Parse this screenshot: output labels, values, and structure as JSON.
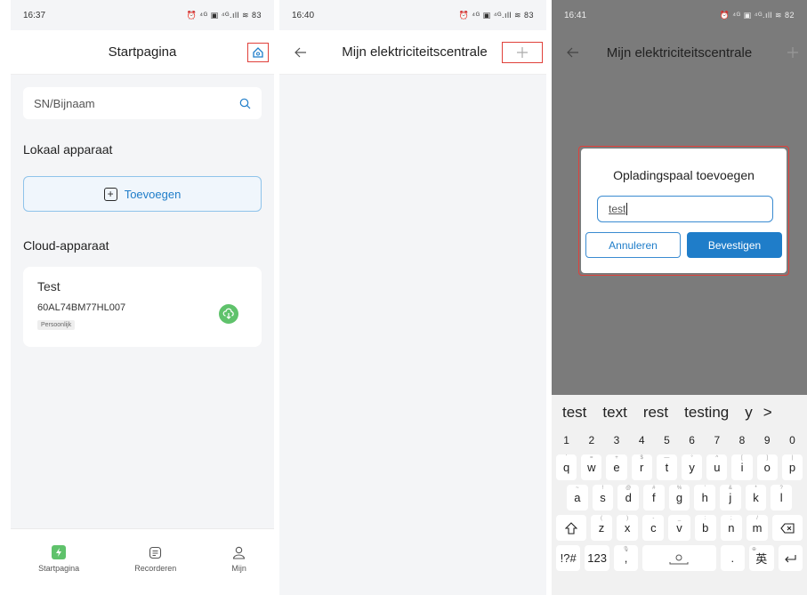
{
  "colors": {
    "accent": "#1f7dc9",
    "highlight": "#e0403a",
    "green": "#5fc26b"
  },
  "screen1": {
    "time": "16:37",
    "status_icons": "⏰ ⁴ᴳ ▣ ⁴ᴳ.ıll ≋ 83",
    "title": "Startpagina",
    "search_placeholder": "SN/Bijnaam",
    "local_section": "Lokaal apparaat",
    "add_label": "Toevoegen",
    "cloud_section": "Cloud-apparaat",
    "device": {
      "name": "Test",
      "sn": "60AL74BM77HL007",
      "tag": "Persoonlijk"
    },
    "tabs": [
      "Startpagina",
      "Recorderen",
      "Mijn"
    ]
  },
  "screen2": {
    "time": "16:40",
    "status_icons": "⏰ ⁴ᴳ ▣ ⁴ᴳ.ıll ≋ 83",
    "title": "Mijn elektriciteitscentrale"
  },
  "screen3": {
    "time": "16:41",
    "status_icons": "⏰ ⁴ᴳ ▣ ⁴ᴳ.ıll ≋ 82",
    "title": "Mijn elektriciteitscentrale",
    "dialog": {
      "title": "Opladingspaal toevoegen",
      "input_value": "test",
      "cancel": "Annuleren",
      "confirm": "Bevestigen"
    },
    "suggestions": [
      "test",
      "text",
      "rest",
      "testing",
      "y"
    ],
    "suggest_more": ">",
    "number_row": [
      "1",
      "2",
      "3",
      "4",
      "5",
      "6",
      "7",
      "8",
      "9",
      "0"
    ],
    "row1": [
      "q",
      "w",
      "e",
      "r",
      "t",
      "y",
      "u",
      "i",
      "o",
      "p"
    ],
    "row1_hints": [
      "`",
      "=",
      "+",
      "$",
      "—",
      "°",
      "^",
      "[",
      "]",
      "|"
    ],
    "row2": [
      "a",
      "s",
      "d",
      "f",
      "g",
      "h",
      "j",
      "k",
      "l"
    ],
    "row2_hints": [
      "~",
      "!",
      "@",
      "#",
      "%",
      "'",
      "&",
      "*",
      "?"
    ],
    "row3": [
      "z",
      "x",
      "c",
      "v",
      "b",
      "n",
      "m"
    ],
    "row3_hints": [
      "(",
      ")",
      "-",
      "_",
      ":",
      ";",
      "/"
    ],
    "symbols_key": "!?#",
    "num_key": "123",
    "comma_key": ",",
    "period_key": ".",
    "lang_key": "英"
  }
}
